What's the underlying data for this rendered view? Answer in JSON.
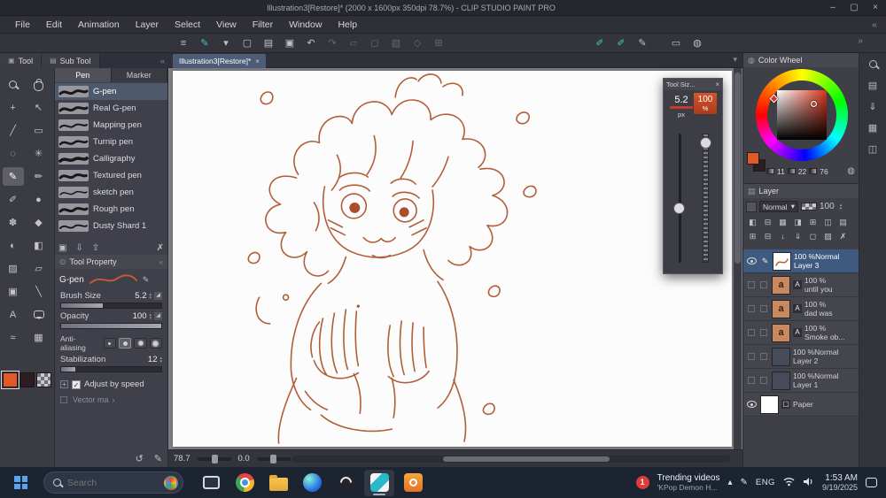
{
  "window": {
    "title": "Illustration3[Restore]* (2000 x 1600px 350dpi 78.7%) - CLIP STUDIO PAINT PRO",
    "minimize": "–",
    "maximize": "▢",
    "close": "×"
  },
  "icons": {
    "chevron_left": "«",
    "chevron_right": "»",
    "dropdown": "▾",
    "up": "▴",
    "down": "▾",
    "close_small": "×",
    "gear": "⊙",
    "pencil": "✎",
    "restore": "↺",
    "expander": "+",
    "arrow_more": "›",
    "check": "✓",
    "tab_tool": "▣",
    "tab_subtool": "▤",
    "text_layer_badge": "A",
    "paper_badge": "▢",
    "circle": "◍",
    "tray_chevron": "▴"
  },
  "menu": {
    "items": [
      "File",
      "Edit",
      "Animation",
      "Layer",
      "Select",
      "View",
      "Filter",
      "Window",
      "Help"
    ]
  },
  "toolbar": {
    "items": [
      {
        "name": "main-menu",
        "glyph": "≡"
      },
      {
        "name": "current-tool",
        "glyph": "✎"
      },
      {
        "name": "tool-dropdown",
        "glyph": "▾"
      },
      {
        "name": "new-canvas",
        "glyph": "▢"
      },
      {
        "name": "open-file",
        "glyph": "▤"
      },
      {
        "name": "save-file",
        "glyph": "▣"
      },
      {
        "name": "undo",
        "glyph": "↶"
      },
      {
        "name": "redo",
        "glyph": "↷"
      },
      {
        "name": "cut",
        "glyph": "▱"
      },
      {
        "name": "copy",
        "glyph": "◻"
      },
      {
        "name": "paste",
        "glyph": "▨"
      },
      {
        "name": "deselect",
        "glyph": "◇"
      },
      {
        "name": "snap-grid",
        "glyph": "⊞"
      },
      {
        "name": "correct-line-on",
        "glyph": "✐"
      },
      {
        "name": "vector-snap-on",
        "glyph": "✐"
      },
      {
        "name": "brush-stroke",
        "glyph": "✎"
      },
      {
        "name": "snap-ruler",
        "glyph": "▭"
      },
      {
        "name": "light-table",
        "glyph": "◍"
      }
    ]
  },
  "palette_tabs": {
    "tool": "Tool",
    "sub_tool": "Sub Tool"
  },
  "tools": {
    "items": [
      {
        "name": "zoom",
        "glyph": ""
      },
      {
        "name": "pan",
        "glyph": ""
      },
      {
        "name": "move",
        "glyph": "+"
      },
      {
        "name": "operation",
        "glyph": "↖"
      },
      {
        "name": "eyedropper",
        "glyph": "╱"
      },
      {
        "name": "marquee",
        "glyph": "▭"
      },
      {
        "name": "lasso",
        "glyph": "◌"
      },
      {
        "name": "auto-select",
        "glyph": "✳"
      },
      {
        "name": "pen",
        "glyph": "✎"
      },
      {
        "name": "pencil",
        "glyph": "✏"
      },
      {
        "name": "brush",
        "glyph": "✐"
      },
      {
        "name": "airbrush",
        "glyph": "●"
      },
      {
        "name": "decoration",
        "glyph": "✽"
      },
      {
        "name": "eraser",
        "glyph": "◆"
      },
      {
        "name": "blend",
        "glyph": "◐"
      },
      {
        "name": "fill",
        "glyph": "◧"
      },
      {
        "name": "gradient",
        "glyph": "▨"
      },
      {
        "name": "figure",
        "glyph": "▱"
      },
      {
        "name": "frame",
        "glyph": "▣"
      },
      {
        "name": "ruler",
        "glyph": "╲"
      },
      {
        "name": "text",
        "glyph": "A"
      },
      {
        "name": "balloon",
        "glyph": ""
      },
      {
        "name": "line-correction",
        "glyph": "≈"
      },
      {
        "name": "material",
        "glyph": "▦"
      }
    ]
  },
  "swatches": {
    "main_color": "#e05a28",
    "sub_color": "#2c1d20"
  },
  "subtool": {
    "tabs": [
      "Pen",
      "Marker"
    ],
    "selected_tab": "Pen",
    "pens": [
      "G-pen",
      "Real G-pen",
      "Mapping pen",
      "Turnip pen",
      "Calligraphy",
      "Textured pen",
      "sketch pen",
      "Rough pen",
      "Dusty Shard 1"
    ],
    "footer_icons": [
      {
        "name": "show-as-list",
        "glyph": "▣"
      },
      {
        "name": "import-sub-tool",
        "glyph": "⇩"
      },
      {
        "name": "export-sub-tool",
        "glyph": "⇧"
      },
      {
        "name": "delete-sub-tool",
        "glyph": "✗"
      }
    ]
  },
  "tool_property": {
    "title": "Tool Property",
    "tool": "G-pen",
    "brush_size_label": "Brush Size",
    "brush_size": "5.2",
    "opacity_label": "Opacity",
    "opacity": "100",
    "anti_aliasing_label": "Anti-aliasing",
    "stabilization_label": "Stabilization",
    "stabilization": "12",
    "adjust_by_speed_label": "Adjust by speed",
    "vector_label": "Vector ma"
  },
  "canvas": {
    "tab": "Illustration3[Restore]*",
    "zoom": "78.7",
    "rotation": "0.0"
  },
  "tool_size_panel": {
    "title": "Tool Siz...",
    "size": "5.2",
    "size_unit": "px",
    "percent": "100",
    "percent_unit": "%"
  },
  "color_wheel": {
    "title": "Color Wheel",
    "values": [
      "11",
      "22",
      "76"
    ]
  },
  "layer_panel": {
    "title": "Layer",
    "blend_mode": "Normal",
    "opacity": "100",
    "icon_row1": [
      {
        "name": "clip-to-layer",
        "glyph": "◧"
      },
      {
        "name": "lock-layer",
        "glyph": "⊟"
      },
      {
        "name": "lock-transparent-pixels",
        "glyph": "▦"
      },
      {
        "name": "enable-mask",
        "glyph": "◨"
      },
      {
        "name": "set-ruler",
        "glyph": "⊞"
      },
      {
        "name": "layer-color",
        "glyph": "◫"
      },
      {
        "name": "reference-layer",
        "glyph": "▤"
      }
    ],
    "icon_row2": [
      {
        "name": "new-raster-layer",
        "glyph": "⊞"
      },
      {
        "name": "new-layer-folder",
        "glyph": "⊟"
      },
      {
        "name": "transfer-to-lower",
        "glyph": "↓"
      },
      {
        "name": "merge-down",
        "glyph": "⇓"
      },
      {
        "name": "create-mask",
        "glyph": "◻"
      },
      {
        "name": "apply-mask",
        "glyph": "▨"
      },
      {
        "name": "delete-layer",
        "glyph": "✗"
      }
    ],
    "layers": [
      {
        "info": "100 %Normal",
        "name": "Layer 3"
      },
      {
        "info": "100 %",
        "name": "until you"
      },
      {
        "info": "100 %",
        "name": "dad was"
      },
      {
        "info": "100 %",
        "name": "Smoke ob..."
      },
      {
        "info": "100 %Normal",
        "name": "Layer 2"
      },
      {
        "info": "100 %Normal",
        "name": "Layer 1"
      },
      {
        "info": "",
        "name": "Paper"
      }
    ]
  },
  "edge_strip": [
    {
      "name": "quick-access",
      "glyph": ""
    },
    {
      "name": "material-panel",
      "glyph": "▤"
    },
    {
      "name": "download-panel",
      "glyph": "⇓"
    },
    {
      "name": "color-set-panel",
      "glyph": "▦"
    },
    {
      "name": "sub-view-panel",
      "glyph": "◫"
    }
  ],
  "taskbar": {
    "search_placeholder": "Search",
    "notification": {
      "badge": "1",
      "line1": "Trending videos",
      "line2": "'KPop Demon H..."
    },
    "lang": "ENG",
    "time": "1:53 AM",
    "date": "9/19/2025"
  }
}
